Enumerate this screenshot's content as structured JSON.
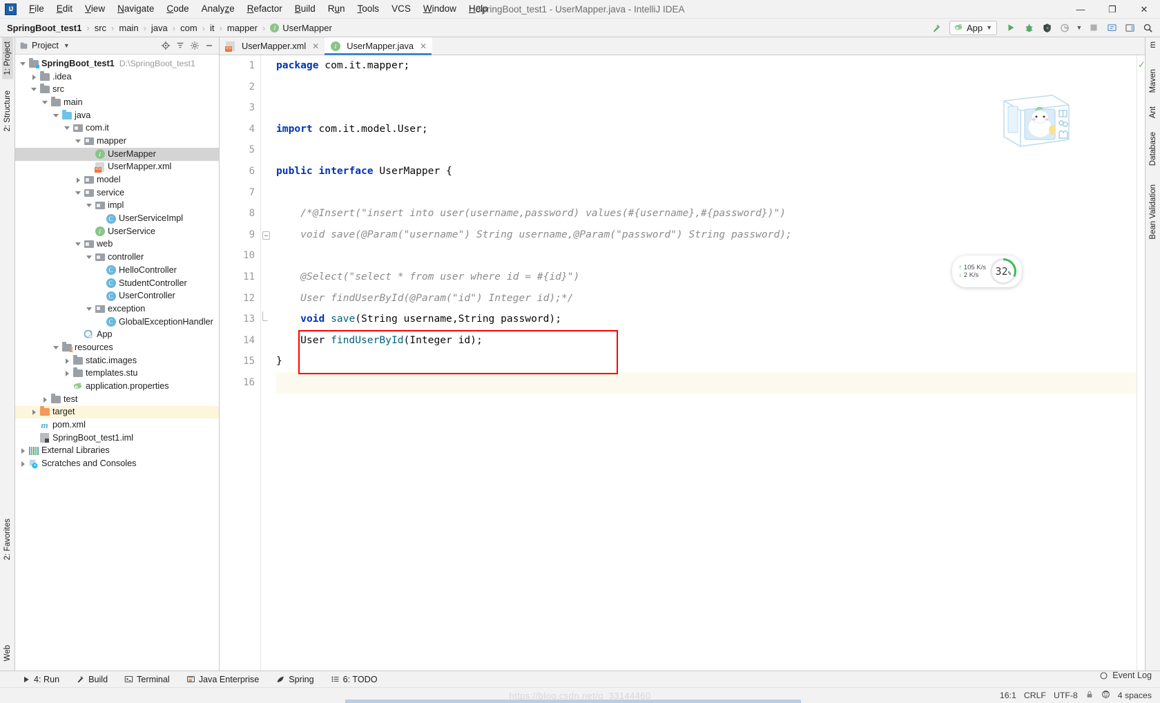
{
  "window": {
    "title": "SpringBoot_test1 - UserMapper.java - IntelliJ IDEA",
    "logo": "IJ",
    "minimize": "—",
    "maximize": "❐",
    "close": "✕"
  },
  "menubar": {
    "items": [
      "File",
      "Edit",
      "View",
      "Navigate",
      "Code",
      "Analyze",
      "Refactor",
      "Build",
      "Run",
      "Tools",
      "VCS",
      "Window",
      "Help"
    ]
  },
  "breadcrumb": {
    "items": [
      "SpringBoot_test1",
      "src",
      "main",
      "java",
      "com",
      "it",
      "mapper",
      "UserMapper"
    ],
    "separator": "›"
  },
  "navtoolbar": {
    "run_config": "App",
    "icons": [
      "hammer-build-icon",
      "run-icon",
      "debug-icon",
      "run-coverage-icon",
      "profiler-icon",
      "stop-icon",
      "update-app-icon",
      "layout-icon",
      "search-everywhere-icon"
    ]
  },
  "left_rail": {
    "items": [
      "1: Project",
      "2: Structure",
      "2: Favorites",
      "Web"
    ]
  },
  "right_rail": {
    "items": [
      "m",
      "Maven",
      "Ant",
      "Database",
      "Bean Validation"
    ]
  },
  "project_panel": {
    "title": "Project",
    "actions": [
      "locate-icon",
      "collapse-all-icon",
      "settings-icon",
      "hide-icon"
    ],
    "tree": [
      {
        "label": "SpringBoot_test1",
        "path": "D:\\SpringBoot_test1",
        "depth": 0,
        "arrow": "open",
        "icon": "project-module-icon",
        "bold": true
      },
      {
        "label": ".idea",
        "depth": 1,
        "arrow": "closed",
        "icon": "folder-gray-icon"
      },
      {
        "label": "src",
        "depth": 1,
        "arrow": "open",
        "icon": "folder-gray-icon"
      },
      {
        "label": "main",
        "depth": 2,
        "arrow": "open",
        "icon": "folder-gray-icon"
      },
      {
        "label": "java",
        "depth": 3,
        "arrow": "open",
        "icon": "folder-source-blue-icon"
      },
      {
        "label": "com.it",
        "depth": 4,
        "arrow": "open",
        "icon": "package-icon"
      },
      {
        "label": "mapper",
        "depth": 5,
        "arrow": "open",
        "icon": "package-icon"
      },
      {
        "label": "UserMapper",
        "depth": 6,
        "arrow": "none",
        "icon": "interface-icon",
        "selected": true
      },
      {
        "label": "UserMapper.xml",
        "depth": 6,
        "arrow": "none",
        "icon": "xml-file-icon"
      },
      {
        "label": "model",
        "depth": 5,
        "arrow": "closed",
        "icon": "package-icon"
      },
      {
        "label": "service",
        "depth": 5,
        "arrow": "open",
        "icon": "package-icon"
      },
      {
        "label": "impl",
        "depth": 6,
        "arrow": "open",
        "icon": "package-icon"
      },
      {
        "label": "UserServiceImpl",
        "depth": 7,
        "arrow": "none",
        "icon": "class-icon"
      },
      {
        "label": "UserService",
        "depth": 6,
        "arrow": "none",
        "icon": "interface-icon"
      },
      {
        "label": "web",
        "depth": 5,
        "arrow": "open",
        "icon": "package-icon"
      },
      {
        "label": "controller",
        "depth": 6,
        "arrow": "open",
        "icon": "package-icon"
      },
      {
        "label": "HelloController",
        "depth": 7,
        "arrow": "none",
        "icon": "class-icon"
      },
      {
        "label": "StudentController",
        "depth": 7,
        "arrow": "none",
        "icon": "class-icon"
      },
      {
        "label": "UserController",
        "depth": 7,
        "arrow": "none",
        "icon": "class-icon"
      },
      {
        "label": "exception",
        "depth": 6,
        "arrow": "open",
        "icon": "package-icon"
      },
      {
        "label": "GlobalExceptionHandler",
        "depth": 7,
        "arrow": "none",
        "icon": "class-icon"
      },
      {
        "label": "App",
        "depth": 5,
        "arrow": "none",
        "icon": "spring-boot-icon"
      },
      {
        "label": "resources",
        "depth": 3,
        "arrow": "open",
        "icon": "folder-resources-icon"
      },
      {
        "label": "static.images",
        "depth": 4,
        "arrow": "closed",
        "icon": "folder-gray-icon"
      },
      {
        "label": "templates.stu",
        "depth": 4,
        "arrow": "closed",
        "icon": "folder-gray-icon"
      },
      {
        "label": "application.properties",
        "depth": 4,
        "arrow": "none",
        "icon": "spring-properties-icon"
      },
      {
        "label": "test",
        "depth": 2,
        "arrow": "closed",
        "icon": "folder-gray-icon"
      },
      {
        "label": "target",
        "depth": 1,
        "arrow": "closed",
        "icon": "folder-orange-icon",
        "highlight": true
      },
      {
        "label": "pom.xml",
        "depth": 1,
        "arrow": "none",
        "icon": "maven-icon"
      },
      {
        "label": "SpringBoot_test1.iml",
        "depth": 1,
        "arrow": "none",
        "icon": "iml-file-icon"
      },
      {
        "label": "External Libraries",
        "depth": 0,
        "arrow": "closed",
        "icon": "libraries-icon"
      },
      {
        "label": "Scratches and Consoles",
        "depth": 0,
        "arrow": "closed",
        "icon": "scratches-icon"
      }
    ]
  },
  "editor": {
    "tabs": [
      {
        "label": "UserMapper.xml",
        "icon": "xml-file-icon",
        "active": false
      },
      {
        "label": "UserMapper.java",
        "icon": "interface-icon",
        "active": true
      }
    ],
    "close_glyph": "✕",
    "line_numbers": [
      "1",
      "2",
      "3",
      "4",
      "5",
      "6",
      "7",
      "8",
      "9",
      "10",
      "11",
      "12",
      "13",
      "14",
      "15",
      "16"
    ],
    "lines": [
      {
        "n": 1,
        "tokens": [
          {
            "t": "package ",
            "c": "kw"
          },
          {
            "t": "com.it.mapper;",
            "c": "plain"
          }
        ]
      },
      {
        "n": 2,
        "tokens": []
      },
      {
        "n": 3,
        "tokens": []
      },
      {
        "n": 4,
        "tokens": [
          {
            "t": "import ",
            "c": "kw"
          },
          {
            "t": "com.it.model.User;",
            "c": "plain"
          }
        ]
      },
      {
        "n": 5,
        "tokens": []
      },
      {
        "n": 6,
        "tokens": [
          {
            "t": "public ",
            "c": "kw"
          },
          {
            "t": "interface ",
            "c": "kw"
          },
          {
            "t": "UserMapper {",
            "c": "plain"
          }
        ]
      },
      {
        "n": 7,
        "tokens": []
      },
      {
        "n": 8,
        "tokens": [
          {
            "t": "    /*@Insert(\"insert into user(username,password) values(#{username},#{password})\")",
            "c": "cmt"
          }
        ]
      },
      {
        "n": 9,
        "tokens": [
          {
            "t": "    void save(@Param(\"username\") String username,@Param(\"password\") String password);",
            "c": "cmt"
          }
        ]
      },
      {
        "n": 10,
        "tokens": []
      },
      {
        "n": 11,
        "tokens": [
          {
            "t": "    @Select(\"select * from user where id = #{id}\")",
            "c": "cmt"
          }
        ]
      },
      {
        "n": 12,
        "tokens": [
          {
            "t": "    User findUserById(@Param(\"id\") Integer id);*/",
            "c": "cmt"
          }
        ]
      },
      {
        "n": 13,
        "tokens": [
          {
            "t": "    ",
            "c": "plain"
          },
          {
            "t": "void",
            "c": "kw"
          },
          {
            "t": " ",
            "c": "plain"
          },
          {
            "t": "save",
            "c": "mth"
          },
          {
            "t": "(String username,String password);",
            "c": "plain"
          }
        ]
      },
      {
        "n": 14,
        "tokens": [
          {
            "t": "    User ",
            "c": "plain"
          },
          {
            "t": "findUserById",
            "c": "mth"
          },
          {
            "t": "(Integer id);",
            "c": "plain"
          }
        ]
      },
      {
        "n": 15,
        "tokens": [
          {
            "t": "}",
            "c": "plain"
          }
        ]
      },
      {
        "n": 16,
        "tokens": [],
        "cursorline": true
      }
    ]
  },
  "overlays": {
    "network": {
      "upload": "105 K/s",
      "download": "2  K/s",
      "up_arrow": "↑",
      "down_arrow": "↓"
    },
    "cpu": {
      "value": "32",
      "unit": "%"
    }
  },
  "bottom_toolbar": {
    "items": [
      {
        "label": "4: Run",
        "mnemonic": "4",
        "icon": "run-icon"
      },
      {
        "label": "Build",
        "icon": "hammer-build-icon"
      },
      {
        "label": "Terminal",
        "icon": "terminal-icon"
      },
      {
        "label": "Java Enterprise",
        "icon": "java-enterprise-icon"
      },
      {
        "label": "Spring",
        "icon": "spring-leaf-icon"
      },
      {
        "label": "6: TODO",
        "mnemonic": "6",
        "icon": "todo-list-icon"
      }
    ]
  },
  "status_bar": {
    "event_log": "Event Log",
    "caret_position": "16:1",
    "line_separator": "CRLF",
    "encoding": "UTF-8",
    "indent": "4 spaces",
    "lock_icon": "lock-icon",
    "inspector_icon": "inspection-face-icon",
    "watermark": "https://blog.csdn.net/q_33144460"
  }
}
